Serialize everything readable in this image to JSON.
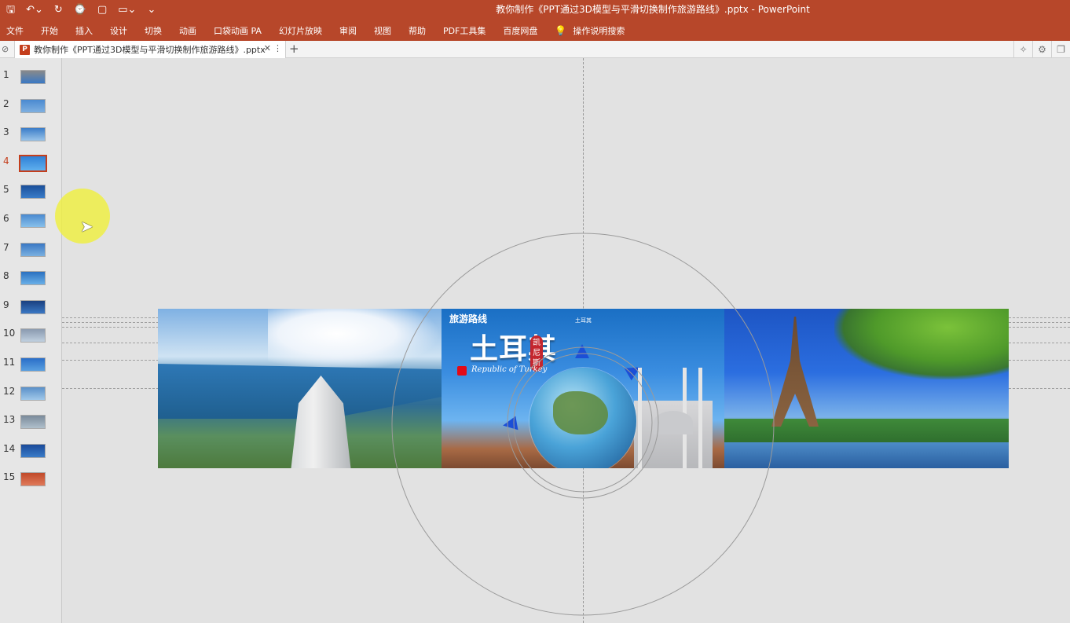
{
  "window": {
    "title": "教你制作《PPT通过3D模型与平滑切换制作旅游路线》.pptx  -  PowerPoint"
  },
  "qat": {
    "save_icon": "save-icon",
    "undo_icon": "undo-icon",
    "redo_icon": "redo-icon",
    "present_icon": "present-icon",
    "new_icon": "new-file-icon",
    "open_icon": "open-folder-icon",
    "more_icon": "customize-icon"
  },
  "ribbon": {
    "tabs": [
      "文件",
      "开始",
      "插入",
      "设计",
      "切换",
      "动画",
      "口袋动画 PA",
      "幻灯片放映",
      "审阅",
      "视图",
      "帮助",
      "PDF工具集",
      "百度网盘"
    ],
    "tell_me": "操作说明搜索"
  },
  "doctab": {
    "label": "教你制作《PPT通过3D模型与平滑切换制作旅游路线》.pptx",
    "close": "✕",
    "more": "⋮",
    "new": "+"
  },
  "thumbnails": [
    {
      "num": "1"
    },
    {
      "num": "2"
    },
    {
      "num": "3"
    },
    {
      "num": "4",
      "selected": true
    },
    {
      "num": "5"
    },
    {
      "num": "6"
    },
    {
      "num": "7"
    },
    {
      "num": "8"
    },
    {
      "num": "9"
    },
    {
      "num": "10"
    },
    {
      "num": "11"
    },
    {
      "num": "12"
    },
    {
      "num": "13"
    },
    {
      "num": "14"
    },
    {
      "num": "15"
    }
  ],
  "slide": {
    "panel2": {
      "route_title": "旅游路线",
      "country": "土耳其",
      "tag": "凯尼斯",
      "republic": "Republic of Turkey",
      "heading": "土耳其"
    }
  },
  "colors": {
    "accent": "#b7472a",
    "selected": "#c43e1c"
  }
}
